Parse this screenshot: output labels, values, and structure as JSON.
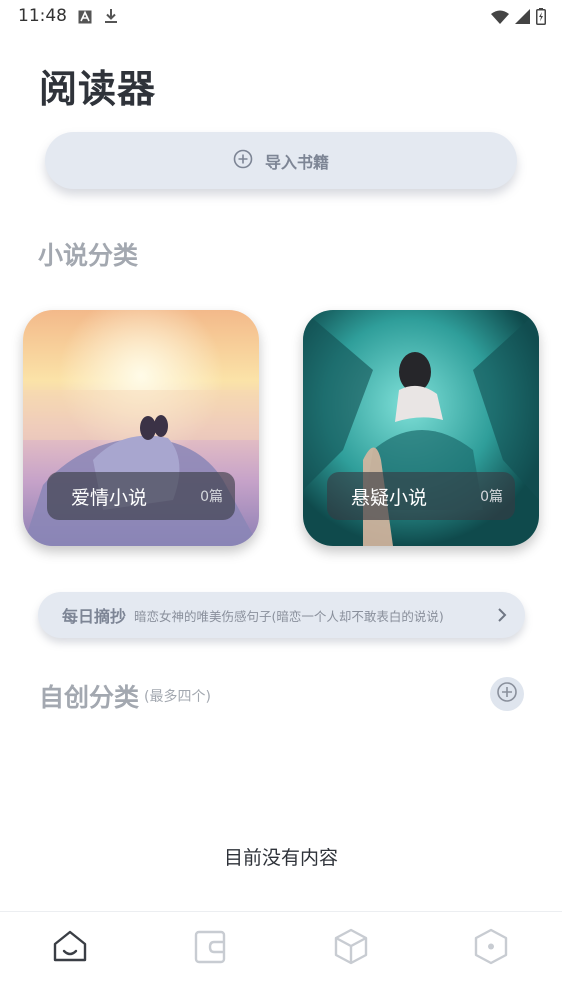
{
  "status_bar": {
    "time": "11:48",
    "left_icons": [
      "font-a-icon",
      "download-icon"
    ],
    "right_icons": [
      "wifi-icon",
      "signal-icon",
      "battery-icon"
    ]
  },
  "header": {
    "title": "阅读器"
  },
  "import": {
    "label": "导入书籍",
    "icon": "plus-circle-icon"
  },
  "novel_section": {
    "title": "小说分类",
    "cards": [
      {
        "name": "爱情小说",
        "count": "0篇"
      },
      {
        "name": "悬疑小说",
        "count": "0篇"
      }
    ]
  },
  "daily_quote": {
    "title": "每日摘抄",
    "text": "暗恋女神的唯美伤感句子(暗恋一个人却不敢表白的说说)",
    "icon": "chevron-right-icon"
  },
  "custom_section": {
    "title": "自创分类",
    "subtitle": "(最多四个)",
    "add_icon": "plus-circle-icon"
  },
  "empty_state": {
    "text": "目前没有内容"
  },
  "bottom_nav": {
    "items": [
      "home-icon",
      "wallet-icon",
      "cube-icon",
      "settings-hexagon-icon"
    ],
    "active_color": "#3a3e45",
    "inactive_color": "#c8ccd2"
  },
  "colors": {
    "accent_bg": "#e4e9f1",
    "muted_text": "#a3a8b0",
    "title_text": "#2f333a"
  }
}
